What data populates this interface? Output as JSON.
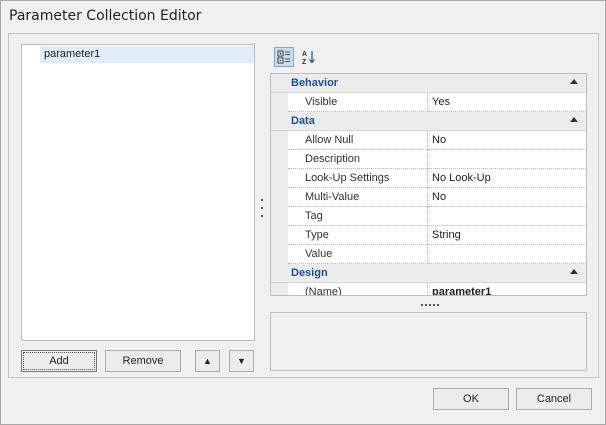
{
  "window": {
    "title": "Parameter Collection Editor"
  },
  "parameters": {
    "items": [
      "parameter1"
    ]
  },
  "list_buttons": {
    "add": "Add",
    "remove": "Remove"
  },
  "toolbar": {
    "categorized_icon": "categorized-icon",
    "alphabetical_icon": "alphabetical-sort-icon"
  },
  "property_grid": {
    "categories": [
      {
        "name": "Behavior",
        "properties": [
          {
            "name": "Visible",
            "value": "Yes"
          }
        ]
      },
      {
        "name": "Data",
        "properties": [
          {
            "name": "Allow Null",
            "value": "No"
          },
          {
            "name": "Description",
            "value": ""
          },
          {
            "name": "Look-Up Settings",
            "value": "No Look-Up"
          },
          {
            "name": "Multi-Value",
            "value": "No"
          },
          {
            "name": "Tag",
            "value": ""
          },
          {
            "name": "Type",
            "value": "String"
          },
          {
            "name": "Value",
            "value": ""
          }
        ]
      },
      {
        "name": "Design",
        "properties": [
          {
            "name": "(Name)",
            "value": "parameter1"
          }
        ]
      }
    ]
  },
  "dialog_buttons": {
    "ok": "OK",
    "cancel": "Cancel"
  },
  "colors": {
    "category_text": "#1c4f93",
    "selection": "#e1ecf9",
    "toolbar_active": "#c9dcf2"
  }
}
